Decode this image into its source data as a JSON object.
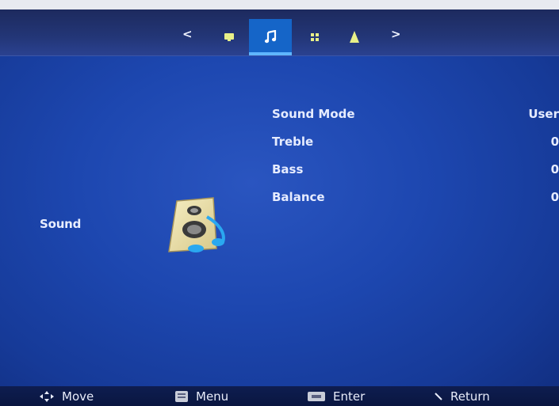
{
  "top_nav": {
    "prev_arrow": "<",
    "next_arrow": ">",
    "tabs": [
      {
        "icon": "picture-icon"
      },
      {
        "icon": "music-note-icon",
        "active": true
      },
      {
        "icon": "grid-icon"
      },
      {
        "icon": "lock-bell-icon"
      }
    ]
  },
  "section": {
    "title": "Sound",
    "icon": "speaker-icon"
  },
  "settings": [
    {
      "label": "Sound Mode",
      "value": "User"
    },
    {
      "label": "Treble",
      "value": "0"
    },
    {
      "label": "Bass",
      "value": "0"
    },
    {
      "label": "Balance",
      "value": "0"
    }
  ],
  "hints": {
    "move": "Move",
    "menu": "Menu",
    "enter": "Enter",
    "return": "Return"
  },
  "colors": {
    "background": "#1d47b0",
    "active_tab": "#1565c8",
    "active_underline": "#5fb6ff",
    "bottom_bar": "#0e1d50"
  }
}
